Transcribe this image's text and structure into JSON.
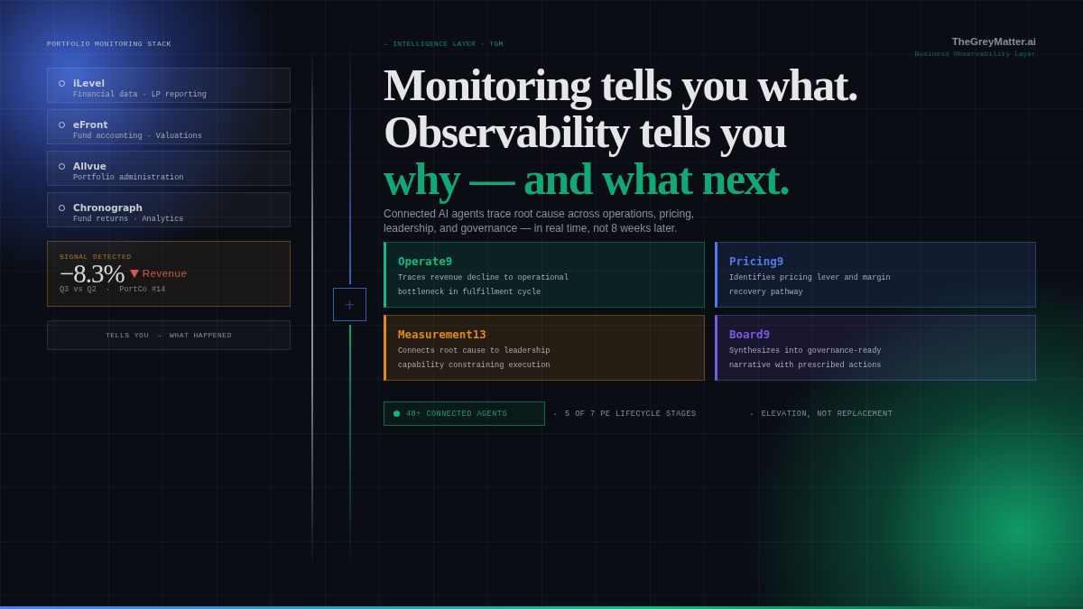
{
  "stack": {
    "heading": "PORTFOLIO MONITORING STACK",
    "tools": [
      {
        "name": "iLevel",
        "detail": "Financial data · LP reporting"
      },
      {
        "name": "eFront",
        "detail": "Fund accounting · Valuations"
      },
      {
        "name": "Allvue",
        "detail": "Portfolio administration"
      },
      {
        "name": "Chronograph",
        "detail": "Fund returns · Analytics"
      }
    ],
    "signal": {
      "label": "SIGNAL DETECTED",
      "value": "−8.3%",
      "metric": "Revenue",
      "context": "Q3 vs Q2  ·  PortCo #14"
    },
    "footer": {
      "left": "TELLS YOU",
      "arrow": "→",
      "right": "WHAT HAPPENED"
    }
  },
  "connector": {
    "symbol": "+"
  },
  "intel": {
    "eyebrow": "— INTELLIGENCE LAYER · TGM",
    "brand": "TheGreyMatter.ai",
    "tagline": "Business Observability Layer",
    "headline": [
      "Monitoring tells you what.",
      "Observability tells you"
    ],
    "headline_accent": "why — and what next.",
    "lede": "Connected AI agents trace root cause across operations, pricing, leadership, and governance — in real time, not 8 weeks later.",
    "agents": [
      {
        "name": "Operate9",
        "color": "#10b981",
        "description": "Traces revenue decline to operational bottleneck in fulfillment cycle"
      },
      {
        "name": "Pricing9",
        "color": "#4f7be8",
        "description": "Identifies pricing lever and margin recovery pathway"
      },
      {
        "name": "Measurement13",
        "color": "#e08a12",
        "description": "Connects root cause to leadership capability constraining execution"
      },
      {
        "name": "Board9",
        "color": "#7c5be0",
        "description": "Synthesizes into governance-ready narrative with prescribed actions"
      }
    ],
    "stats": [
      {
        "kind": "highlight",
        "text": "40+ CONNECTED AGENTS"
      },
      {
        "kind": "plain",
        "text": "5 OF 7 PE LIFECYCLE STAGES"
      },
      {
        "kind": "plain",
        "text": "ELEVATION, NOT REPLACEMENT"
      }
    ]
  }
}
